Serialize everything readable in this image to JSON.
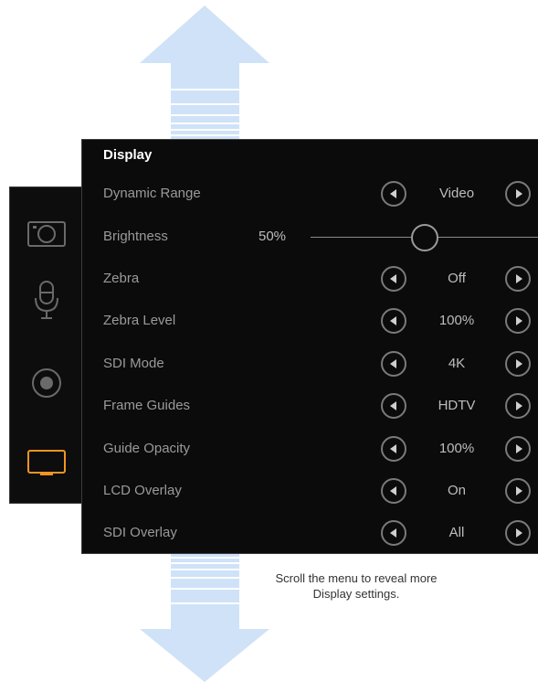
{
  "menu": {
    "title": "Display",
    "rows": [
      {
        "label": "Dynamic Range",
        "value": "Video"
      },
      {
        "label": "Brightness",
        "value": "50%",
        "slider_fraction": 0.5
      },
      {
        "label": "Zebra",
        "value": "Off"
      },
      {
        "label": "Zebra Level",
        "value": "100%"
      },
      {
        "label": "SDI Mode",
        "value": "4K"
      },
      {
        "label": "Frame Guides",
        "value": "HDTV"
      },
      {
        "label": "Guide Opacity",
        "value": "100%"
      },
      {
        "label": "LCD Overlay",
        "value": "On"
      },
      {
        "label": "SDI Overlay",
        "value": "All"
      }
    ]
  },
  "sidebar": {
    "icons": [
      "camera-icon",
      "microphone-icon",
      "record-icon",
      "monitor-icon"
    ],
    "active": "monitor-icon",
    "accent": "#f39325"
  },
  "caption": "Scroll the menu to reveal more Display settings.",
  "colors": {
    "arrow": "#cfe2f7",
    "panel": "#0b0b0b"
  }
}
